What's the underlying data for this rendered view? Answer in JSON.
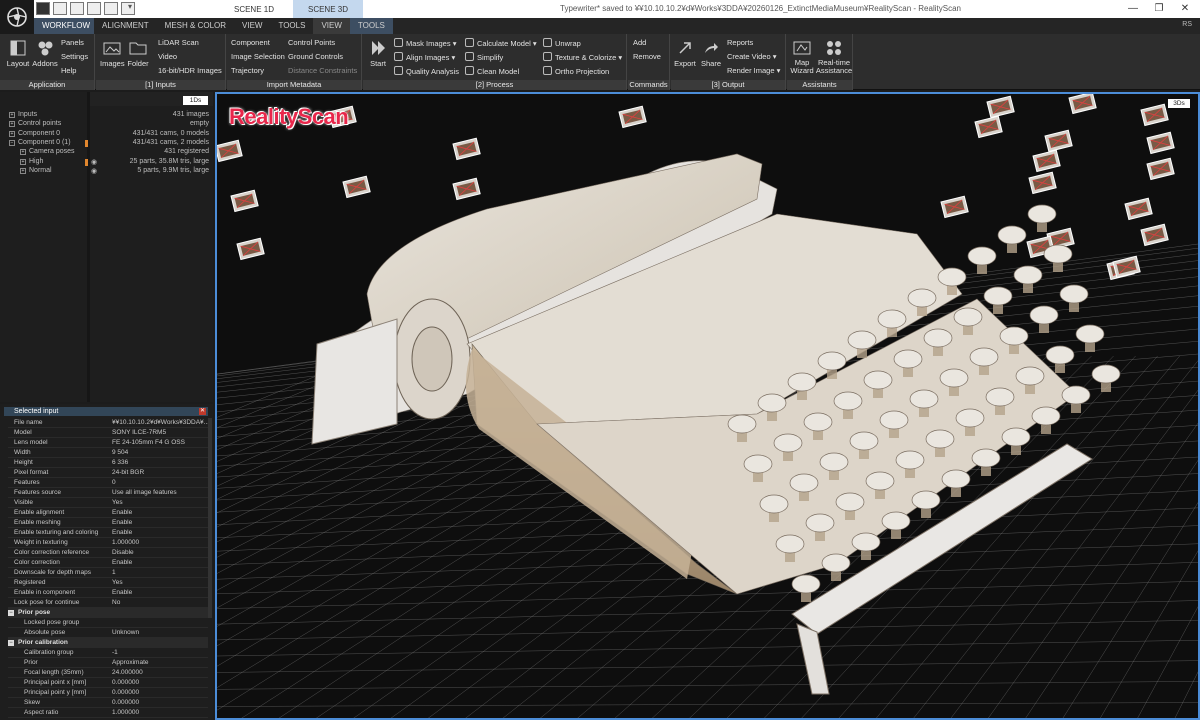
{
  "title_bar": {
    "scene_tabs": [
      "SCENE 1D",
      "SCENE 3D"
    ],
    "window_title": "Typewriter* saved to ¥¥10.10.10.2¥d¥Works¥3DDA¥20260126_ExtinctMediaMuseum¥RealityScan - RealityScan",
    "user_initials": "RS",
    "window_buttons": [
      "—",
      "❐",
      "✕"
    ]
  },
  "ribbon_tabs": [
    "WORKFLOW",
    "ALIGNMENT",
    "MESH & COLOR",
    "VIEW",
    "TOOLS",
    "VIEW",
    "TOOLS"
  ],
  "ribbon": {
    "application": {
      "label": "Application",
      "layout": "Layout",
      "addons": "Addons",
      "panels": "Panels",
      "settings": "Settings",
      "help": "Help"
    },
    "inputs": {
      "label": "[1] Inputs",
      "images": "Images",
      "folder": "Folder",
      "lidar": "LiDAR Scan",
      "video": "Video",
      "hdr": "16-bit/HDR Images"
    },
    "import_metadata": {
      "label": "Import Metadata",
      "component": "Component",
      "image_selection": "Image Selection",
      "trajectory": "Trajectory",
      "control_points": "Control Points",
      "ground_controls": "Ground Controls",
      "distance_constraints": "Distance Constraints"
    },
    "process": {
      "label": "[2] Process",
      "start": "Start",
      "mask_images": "Mask Images",
      "align_images": "Align Images",
      "quality_analysis": "Quality Analysis",
      "calculate_model": "Calculate Model",
      "simplify": "Simplify",
      "clean_model": "Clean Model",
      "unwrap": "Unwrap",
      "texture_colorize": "Texture & Colorize",
      "ortho_projection": "Ortho Projection"
    },
    "commands": {
      "label": "Commands",
      "add": "Add",
      "remove": "Remove"
    },
    "output": {
      "label": "[3] Output",
      "export": "Export",
      "share": "Share",
      "reports": "Reports",
      "create_video": "Create Video",
      "render_image": "Render Image"
    },
    "assistants": {
      "label": "Assistants",
      "map_wizard_1": "Map",
      "map_wizard_2": "Wizard",
      "realtime_1": "Real-time",
      "realtime_2": "Assistance"
    }
  },
  "tree": {
    "badge": "1Ds",
    "rows": [
      {
        "label": "Inputs",
        "value": "431 images",
        "indent": 0,
        "mark": "+"
      },
      {
        "label": "Control points",
        "value": "empty",
        "indent": 0,
        "mark": "+"
      },
      {
        "label": "Component 0",
        "value": "431/431 cams, 0 models",
        "indent": 0,
        "mark": "+"
      },
      {
        "label": "Component 0 (1)",
        "value": "431/431 cams, 2 models",
        "indent": 0,
        "mark": "−"
      },
      {
        "label": "Camera poses",
        "value": "431 registered",
        "indent": 1,
        "mark": "+"
      },
      {
        "label": "High",
        "value": "25 parts, 35.8M tris, large",
        "indent": 1,
        "mark": "+"
      },
      {
        "label": "Normal",
        "value": "5 parts, 9.9M tris, large",
        "indent": 1,
        "mark": "+"
      }
    ]
  },
  "properties": {
    "header": "Selected input",
    "rows": [
      {
        "k": "File name",
        "v": "¥¥10.10.10.2¥d¥Works¥3DDA¥..."
      },
      {
        "k": "Model",
        "v": "SONY ILCE-7RM5"
      },
      {
        "k": "Lens model",
        "v": "FE 24-105mm F4 G OSS"
      },
      {
        "k": "Width",
        "v": "9 504"
      },
      {
        "k": "Height",
        "v": "6 336"
      },
      {
        "k": "Pixel format",
        "v": "24-bit BGR"
      },
      {
        "k": "Features",
        "v": "0"
      },
      {
        "k": "Features source",
        "v": "Use all image features"
      },
      {
        "k": "Visible",
        "v": "Yes"
      },
      {
        "k": "Enable alignment",
        "v": "Enable"
      },
      {
        "k": "Enable meshing",
        "v": "Enable"
      },
      {
        "k": "Enable texturing and coloring",
        "v": "Enable"
      },
      {
        "k": "Weight in texturing",
        "v": "1.000000"
      },
      {
        "k": "Color correction reference",
        "v": "Disable"
      },
      {
        "k": "Color correction",
        "v": "Enable"
      },
      {
        "k": "Downscale for depth maps",
        "v": "1"
      },
      {
        "k": "Registered",
        "v": "Yes"
      },
      {
        "k": "Enable in component",
        "v": "Enable"
      },
      {
        "k": "Lock pose for continue",
        "v": "No"
      },
      {
        "k": "Prior pose",
        "v": "",
        "section": true
      },
      {
        "k": "Locked pose group",
        "v": "",
        "sub": true
      },
      {
        "k": "Absolute pose",
        "v": "Unknown",
        "sub": true
      },
      {
        "k": "Prior calibration",
        "v": "",
        "section": true
      },
      {
        "k": "Calibration group",
        "v": "-1",
        "sub": true
      },
      {
        "k": "Prior",
        "v": "Approximate",
        "sub": true
      },
      {
        "k": "Focal length (35mm)",
        "v": "24.000000",
        "sub": true
      },
      {
        "k": "Principal point x [mm]",
        "v": "0.000000",
        "sub": true
      },
      {
        "k": "Principal point y [mm]",
        "v": "0.000000",
        "sub": true
      },
      {
        "k": "Skew",
        "v": "0.000000",
        "sub": true
      },
      {
        "k": "Aspect ratio",
        "v": "1.000000",
        "sub": true
      }
    ]
  },
  "viewport": {
    "brand": "RealityScan",
    "badge": "3Ds"
  },
  "colors": {
    "accent": "#4c8dd8",
    "brand": "#e8274b",
    "active_tab": "#3d4e62"
  }
}
